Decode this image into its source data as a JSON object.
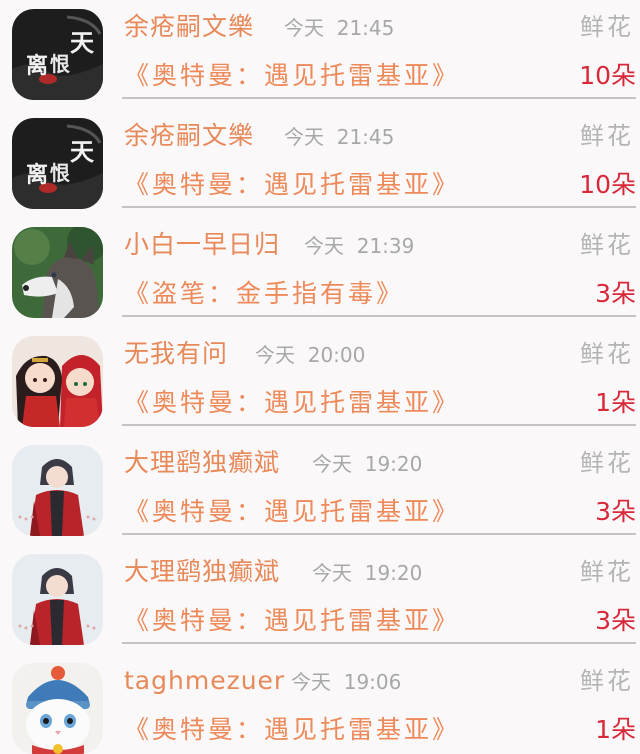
{
  "rows": [
    {
      "user": "余疮嗣文樂",
      "date": "今天",
      "time": "21:45",
      "gift": "鲜花",
      "book": "《奥特曼：遇见托雷基亚》",
      "count": "10朵",
      "avatar": "ink-calligraphy-avatar",
      "avatar_text": "天离恨"
    },
    {
      "user": "余疮嗣文樂",
      "date": "今天",
      "time": "21:45",
      "gift": "鲜花",
      "book": "《奥特曼：遇见托雷基亚》",
      "count": "10朵",
      "avatar": "ink-calligraphy-avatar",
      "avatar_text": "天离恨"
    },
    {
      "user": "小白一早日归",
      "date": "今天",
      "time": "21:39",
      "gift": "鲜花",
      "book": "《盗笔：金手指有毒》",
      "count": "3朵",
      "avatar": "husky-dog-avatar"
    },
    {
      "user": "无我有问",
      "date": "今天",
      "time": "20:00",
      "gift": "鲜花",
      "book": "《奥特曼：遇见托雷基亚》",
      "count": "1朵",
      "avatar": "anime-couple-avatar"
    },
    {
      "user": "大理鹞独癫斌",
      "date": "今天",
      "time": "19:20",
      "gift": "鲜花",
      "book": "《奥特曼：遇见托雷基亚》",
      "count": "3朵",
      "avatar": "anime-swordsman-avatar"
    },
    {
      "user": "大理鹞独癫斌",
      "date": "今天",
      "time": "19:20",
      "gift": "鲜花",
      "book": "《奥特曼：遇见托雷基亚》",
      "count": "3朵",
      "avatar": "anime-swordsman-avatar"
    },
    {
      "user": "taghmezuer",
      "date": "今天",
      "time": "19:06",
      "gift": "鲜花",
      "book": "《奥特曼：遇见托雷基亚》",
      "count": "1朵",
      "avatar": "cat-with-hat-avatar"
    }
  ]
}
